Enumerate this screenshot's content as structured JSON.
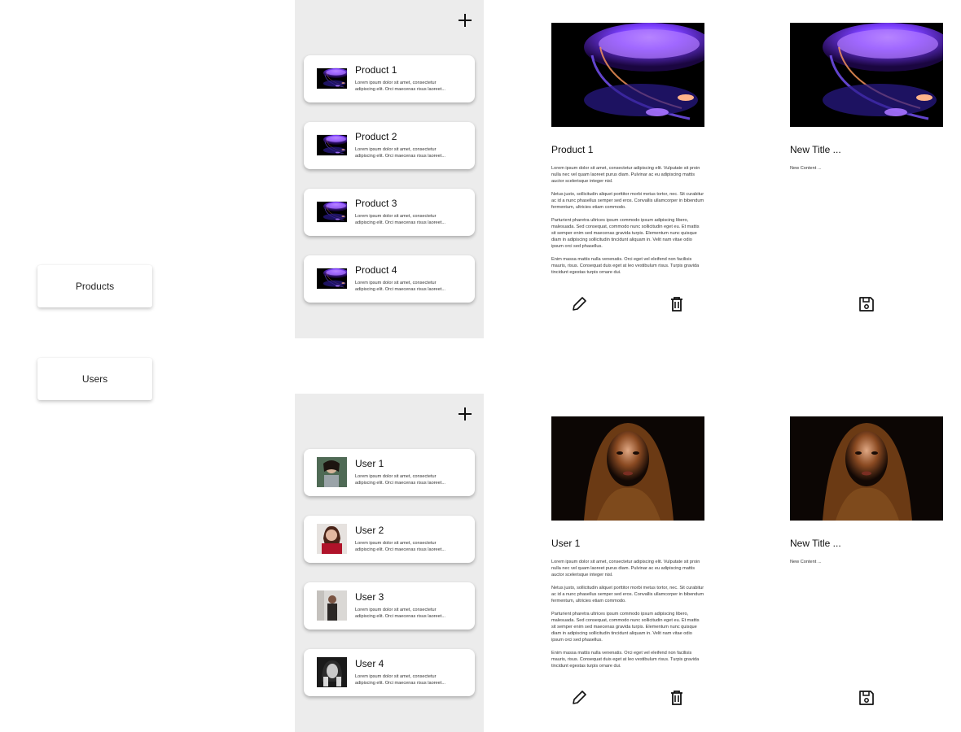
{
  "nav": {
    "products_label": "Products",
    "users_label": "Users"
  },
  "products": {
    "items": [
      {
        "title": "Product 1",
        "desc": "Lorem ipsum dolor sit amet, consectetur adipiscing elit. Orci maecenas risus laoreet..."
      },
      {
        "title": "Product 2",
        "desc": "Lorem ipsum dolor sit amet, consectetur adipiscing elit. Orci maecenas risus laoreet..."
      },
      {
        "title": "Product 3",
        "desc": "Lorem ipsum dolor sit amet, consectetur adipiscing elit. Orci maecenas risus laoreet..."
      },
      {
        "title": "Product 4",
        "desc": "Lorem ipsum dolor sit amet, consectetur adipiscing elit. Orci maecenas risus laoreet..."
      }
    ],
    "detail": {
      "title": "Product 1",
      "paragraphs": [
        "Lorem ipsum dolor sit amet, consectetur adipiscing elit. Vulputate sit proin nulla nec vel quam laoreet purus diam. Pulvinar ac eu adipiscing mattis auctor scelerisque integer nisl.",
        "Netus justo, sollicitudin aliquet porttitor morbi metus tortor, nec. Sit curabitur ac id a nunc phasellus semper sed eros. Convallis ullamcorper in bibendum fermentum, ultricies etiam commodo.",
        "Parturient pharetra ultrices ipsum commodo ipsum adipiscing libero, malesuada. Sed consequat, commodo nunc sollicitudin eget eu. Et mattis sit semper enim sed maecenas gravida turpis. Elementum nunc quisque diam in adipiscing sollicitudin tincidunt aliquam in. Velit nam vitae odio ipsum orci sed phasellus.",
        "Enim massa mattis nulla venenatis. Orci eget vel eleifend non facilisis mauris, risus. Consequat duis eget at leo vestibulum risus. Turpis gravida tincidunt egestas turpis ornare dui."
      ]
    },
    "new_item": {
      "title": "New Title ...",
      "content": "New Content ..."
    }
  },
  "users": {
    "items": [
      {
        "title": "User 1",
        "desc": "Lorem ipsum dolor sit amet, consectetur adipiscing elit. Orci maecenas risus laoreet..."
      },
      {
        "title": "User 2",
        "desc": "Lorem ipsum dolor sit amet, consectetur adipiscing elit. Orci maecenas risus laoreet..."
      },
      {
        "title": "User 3",
        "desc": "Lorem ipsum dolor sit amet, consectetur adipiscing elit. Orci maecenas risus laoreet..."
      },
      {
        "title": "User 4",
        "desc": "Lorem ipsum dolor sit amet, consectetur adipiscing elit. Orci maecenas risus laoreet..."
      }
    ],
    "detail": {
      "title": "User 1",
      "paragraphs": [
        "Lorem ipsum dolor sit amet, consectetur adipiscing elit. Vulputate sit proin nulla nec vel quam laoreet purus diam. Pulvinar ac eu adipiscing mattis auctor scelerisque integer nisl.",
        "Netus justo, sollicitudin aliquet porttitor morbi metus tortor, nec. Sit curabitur ac id a nunc phasellus semper sed eros. Convallis ullamcorper in bibendum fermentum, ultricies etiam commodo.",
        "Parturient pharetra ultrices ipsum commodo ipsum adipiscing libero, malesuada. Sed consequat, commodo nunc sollicitudin eget eu. Et mattis sit semper enim sed maecenas gravida turpis. Elementum nunc quisque diam in adipiscing sollicitudin tincidunt aliquam in. Velit nam vitae odio ipsum orci sed phasellus.",
        "Enim massa mattis nulla venenatis. Orci eget vel eleifend non facilisis mauris, risus. Consequat duis eget at leo vestibulum risus. Turpis gravida tincidunt egestas turpis ornare dui."
      ]
    },
    "new_item": {
      "title": "New Title ...",
      "content": "New Content ..."
    }
  },
  "icons": {
    "add": "plus-icon",
    "edit": "pencil-icon",
    "delete": "trash-icon",
    "save": "floppy-disk-icon"
  },
  "colors": {
    "panel_bg": "#ececec",
    "card_bg": "#ffffff"
  }
}
